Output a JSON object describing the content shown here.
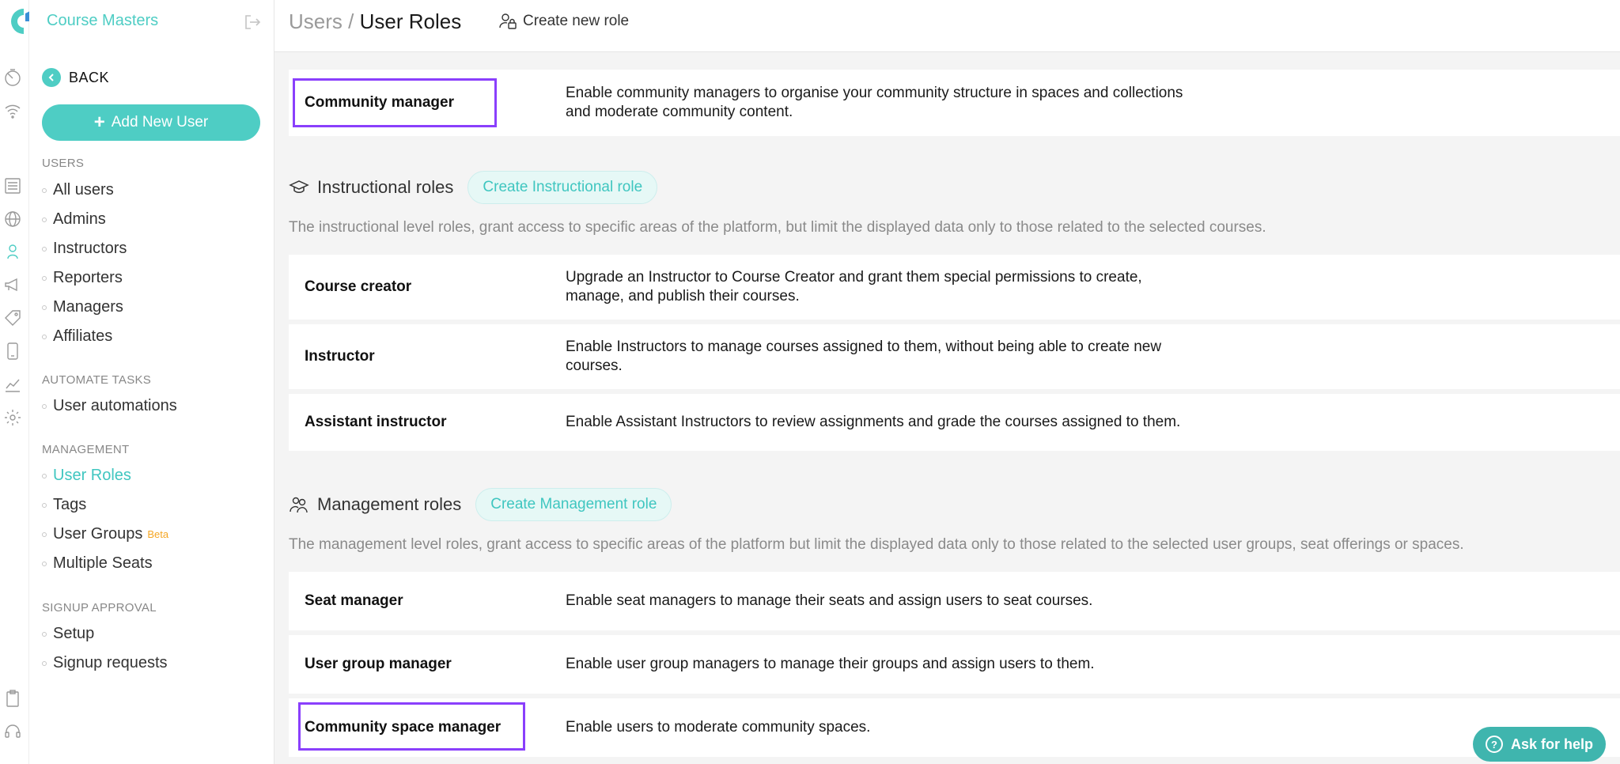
{
  "app": {
    "name": "Course Masters"
  },
  "sidebar": {
    "back_label": "BACK",
    "add_user_label": "Add New User",
    "sections": {
      "users": "USERS",
      "automate": "AUTOMATE TASKS",
      "management": "MANAGEMENT",
      "signup": "SIGNUP APPROVAL"
    },
    "items": {
      "all_users": "All users",
      "admins": "Admins",
      "instructors": "Instructors",
      "reporters": "Reporters",
      "managers": "Managers",
      "affiliates": "Affiliates",
      "user_automations": "User automations",
      "user_roles": "User Roles",
      "tags": "Tags",
      "user_groups": "User Groups",
      "user_groups_badge": "Beta",
      "multiple_seats": "Multiple Seats",
      "setup": "Setup",
      "signup_requests": "Signup requests"
    },
    "active_item": "User Roles"
  },
  "header": {
    "crumb_parent": "Users",
    "crumb_sep": "/",
    "crumb_current": "User Roles",
    "new_role_label": "Create new role"
  },
  "roles": {
    "community_manager": {
      "name": "Community manager",
      "desc_l1": "Enable community managers to organise your community structure in spaces and collections",
      "desc_l2": "and moderate community content."
    },
    "instructional": {
      "title": "Instructional roles",
      "create_label": "Create Instructional role",
      "description": "The instructional level roles, grant access to specific areas of the platform, but limit the displayed data only to those related to the selected courses.",
      "course_creator": {
        "name": "Course creator",
        "desc_l1": "Upgrade an Instructor to Course Creator and grant them special permissions to create,",
        "desc_l2": "manage, and publish their courses."
      },
      "instructor": {
        "name": "Instructor",
        "desc_l1": "Enable Instructors to manage courses assigned to them, without being able to create new",
        "desc_l2": "courses."
      },
      "assistant_instructor": {
        "name": "Assistant instructor",
        "desc": "Enable Assistant Instructors to review assignments and grade the courses assigned to them."
      }
    },
    "management": {
      "title": "Management roles",
      "create_label": "Create Management role",
      "description": "The management level roles, grant access to specific areas of the platform but limit the displayed data only to those related to the selected user groups, seat offerings or spaces.",
      "seat_manager": {
        "name": "Seat manager",
        "desc": "Enable seat managers to manage their seats and assign users to seat courses."
      },
      "user_group_manager": {
        "name": "User group manager",
        "desc": "Enable user group managers to manage their groups and assign users to them."
      },
      "community_space_manager": {
        "name": "Community space manager",
        "desc": "Enable users to moderate community spaces."
      }
    }
  },
  "help": {
    "label": "Ask for help",
    "icon": "?"
  },
  "colors": {
    "accent": "#4ecdc4",
    "highlight": "#8a3ffc",
    "help": "#3fb5ae"
  }
}
